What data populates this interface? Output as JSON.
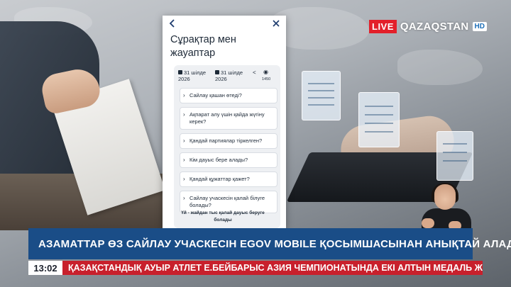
{
  "channel": {
    "live_label": "LIVE",
    "name": "QAZAQSTAN",
    "hd_label": "HD"
  },
  "phone_screen": {
    "title": "Сұрақтар мен жауаптар",
    "date_1": "31 шілде 2026",
    "date_2": "31 шілде 2026",
    "views": "1450",
    "questions": [
      "Сайлау қашан өтеді?",
      "Ақпарат алу үшін қайда жүгіну керек?",
      "Қандай партиялар тіркелген?",
      "Кім дауыс бере алады?",
      "Қандай құжаттар қажет?",
      "Сайлау учаскесін қалай білуге болады?"
    ],
    "bottom_question": "Үй - жайдан тыс қалай дауыс беруге болады"
  },
  "headline": "АЗАМАТТАР ӨЗ САЙЛАУ УЧАСКЕСІН EGOV MOBILE ҚОСЫМШАСЫНАН АНЫҚТАЙ АЛАДЫ",
  "ticker": {
    "time": "13:02",
    "text": "ҚАЗАҚСТАНДЫҚ АУЫР АТЛЕТ Е.БЕЙБАРЫС АЗИЯ ЧЕМПИОНАТЫНДА ЕКІ АЛТЫН МЕДАЛЬ ЖЕҢІП АЛДЫ"
  },
  "colors": {
    "headline_bg": "#1a4d87",
    "ticker_bg": "#c8202c",
    "live_red": "#e3202a"
  }
}
